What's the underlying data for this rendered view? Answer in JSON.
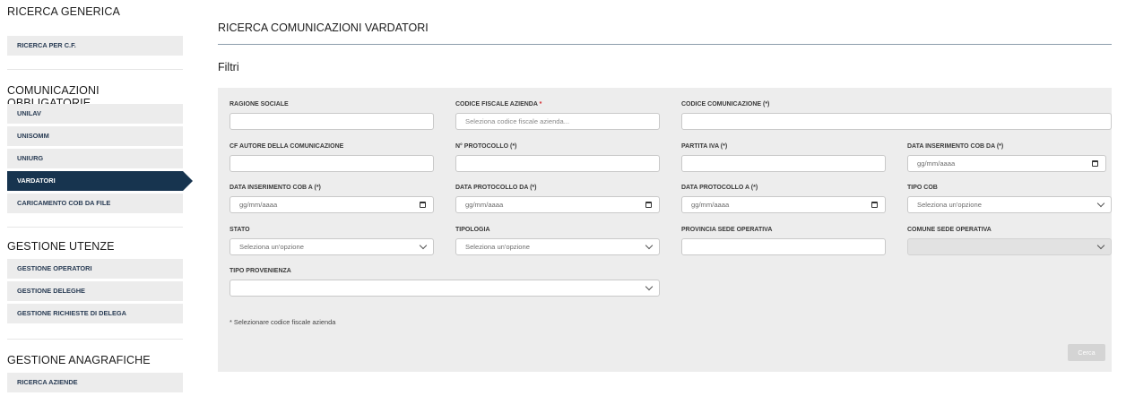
{
  "sidebar": {
    "sections": [
      {
        "title": "RICERCA GENERICA",
        "items": [
          {
            "label": "RICERCA PER C.F.",
            "active": false
          }
        ]
      },
      {
        "title": "COMUNICAZIONI OBBLIGATORIE",
        "items": [
          {
            "label": "UNILAV",
            "active": false
          },
          {
            "label": "UNISOMM",
            "active": false
          },
          {
            "label": "UNIURG",
            "active": false
          },
          {
            "label": "VARDATORI",
            "active": true
          },
          {
            "label": "CARICAMENTO COB DA FILE",
            "active": false
          }
        ]
      },
      {
        "title": "GESTIONE UTENZE",
        "items": [
          {
            "label": "GESTIONE OPERATORI",
            "active": false
          },
          {
            "label": "GESTIONE DELEGHE",
            "active": false
          },
          {
            "label": "GESTIONE RICHIESTE DI DELEGA",
            "active": false
          }
        ]
      },
      {
        "title": "GESTIONE ANAGRAFICHE",
        "items": [
          {
            "label": "RICERCA AZIENDE",
            "active": false
          }
        ]
      }
    ]
  },
  "page_title": "RICERCA COMUNICAZIONI VARDATORI",
  "filters_title": "Filtri",
  "fields": {
    "ragione_sociale": {
      "label": "RAGIONE SOCIALE",
      "value": "",
      "placeholder": ""
    },
    "codice_fiscale_azienda": {
      "label": "CODICE FISCALE AZIENDA",
      "required_mark": "*",
      "value": "",
      "placeholder": "Seleziona codice fiscale azienda..."
    },
    "codice_comunicazione": {
      "label": "CODICE COMUNICAZIONE (*)",
      "value": "",
      "placeholder": ""
    },
    "cf_autore": {
      "label": "CF AUTORE DELLA COMUNICAZIONE",
      "value": "",
      "placeholder": ""
    },
    "n_protocollo": {
      "label": "N° PROTOCOLLO (*)",
      "value": "",
      "placeholder": ""
    },
    "partita_iva": {
      "label": "PARTITA IVA (*)",
      "value": "",
      "placeholder": ""
    },
    "data_ins_cob_da": {
      "label": "DATA INSERIMENTO COB DA (*)",
      "value": "",
      "placeholder": "gg/mm/aaaa"
    },
    "data_ins_cob_a": {
      "label": "DATA INSERIMENTO COB A (*)",
      "value": "",
      "placeholder": "gg/mm/aaaa"
    },
    "data_protocollo_da": {
      "label": "DATA PROTOCOLLO DA (*)",
      "value": "",
      "placeholder": "gg/mm/aaaa"
    },
    "data_protocollo_a": {
      "label": "DATA PROTOCOLLO A (*)",
      "value": "",
      "placeholder": "gg/mm/aaaa"
    },
    "tipo_cob": {
      "label": "TIPO COB",
      "selected": "Seleziona un'opzione"
    },
    "stato": {
      "label": "STATO",
      "selected": "Seleziona un'opzione"
    },
    "tipologia": {
      "label": "TIPOLOGIA",
      "selected": "Seleziona un'opzione"
    },
    "provincia_sede": {
      "label": "PROVINCIA SEDE OPERATIVA",
      "value": "",
      "placeholder": ""
    },
    "comune_sede": {
      "label": "COMUNE SEDE OPERATIVA",
      "selected": "",
      "disabled": true
    },
    "tipo_provenienza": {
      "label": "TIPO PROVENIENZA",
      "selected": ""
    }
  },
  "note": "* Selezionare codice fiscale azienda",
  "search_button": {
    "label": "Cerca",
    "disabled": true
  },
  "icons": {
    "calendar": "calendar-icon",
    "chevron": "chevron-down-icon"
  },
  "colors": {
    "active_nav": "#17344f",
    "panel_bg": "#ededed",
    "required": "#d3252a"
  }
}
